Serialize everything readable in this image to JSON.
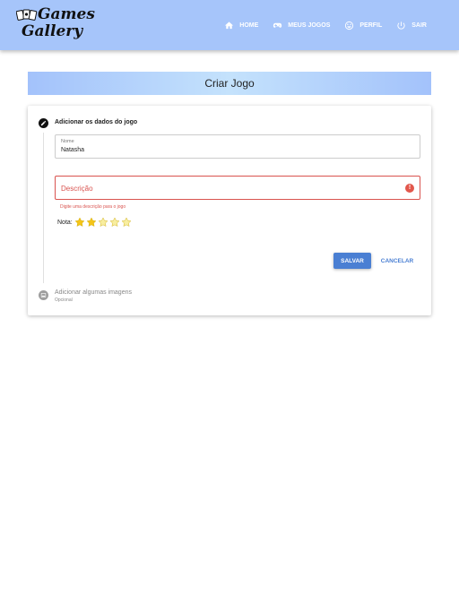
{
  "app": {
    "logo_line1": "Games",
    "logo_line2": "Gallery"
  },
  "nav": [
    {
      "label": "HOME",
      "icon": "home-icon"
    },
    {
      "label": "MEUS JOGOS",
      "icon": "gamepad-icon"
    },
    {
      "label": "PERFIL",
      "icon": "smiley-icon"
    },
    {
      "label": "SAIR",
      "icon": "power-icon"
    }
  ],
  "page": {
    "title": "Criar Jogo"
  },
  "step1": {
    "title": "Adicionar os dados do jogo",
    "name_label": "Nome",
    "name_value": "Natasha",
    "desc_placeholder": "Descrição",
    "desc_error": "Digite uma descrição para o jogo",
    "rating_label": "Nota:",
    "rating_value": 2,
    "rating_max": 5
  },
  "actions": {
    "save": "SALVAR",
    "cancel": "CANCELAR"
  },
  "step2": {
    "title": "Adicionar algumas imagens",
    "subtitle": "Opcional"
  },
  "colors": {
    "topbar": "#a6c5fa",
    "primary": "#4a7fd3",
    "error": "#d9534f",
    "star_filled": "#f5c518",
    "star_empty": "#f8eea0"
  }
}
